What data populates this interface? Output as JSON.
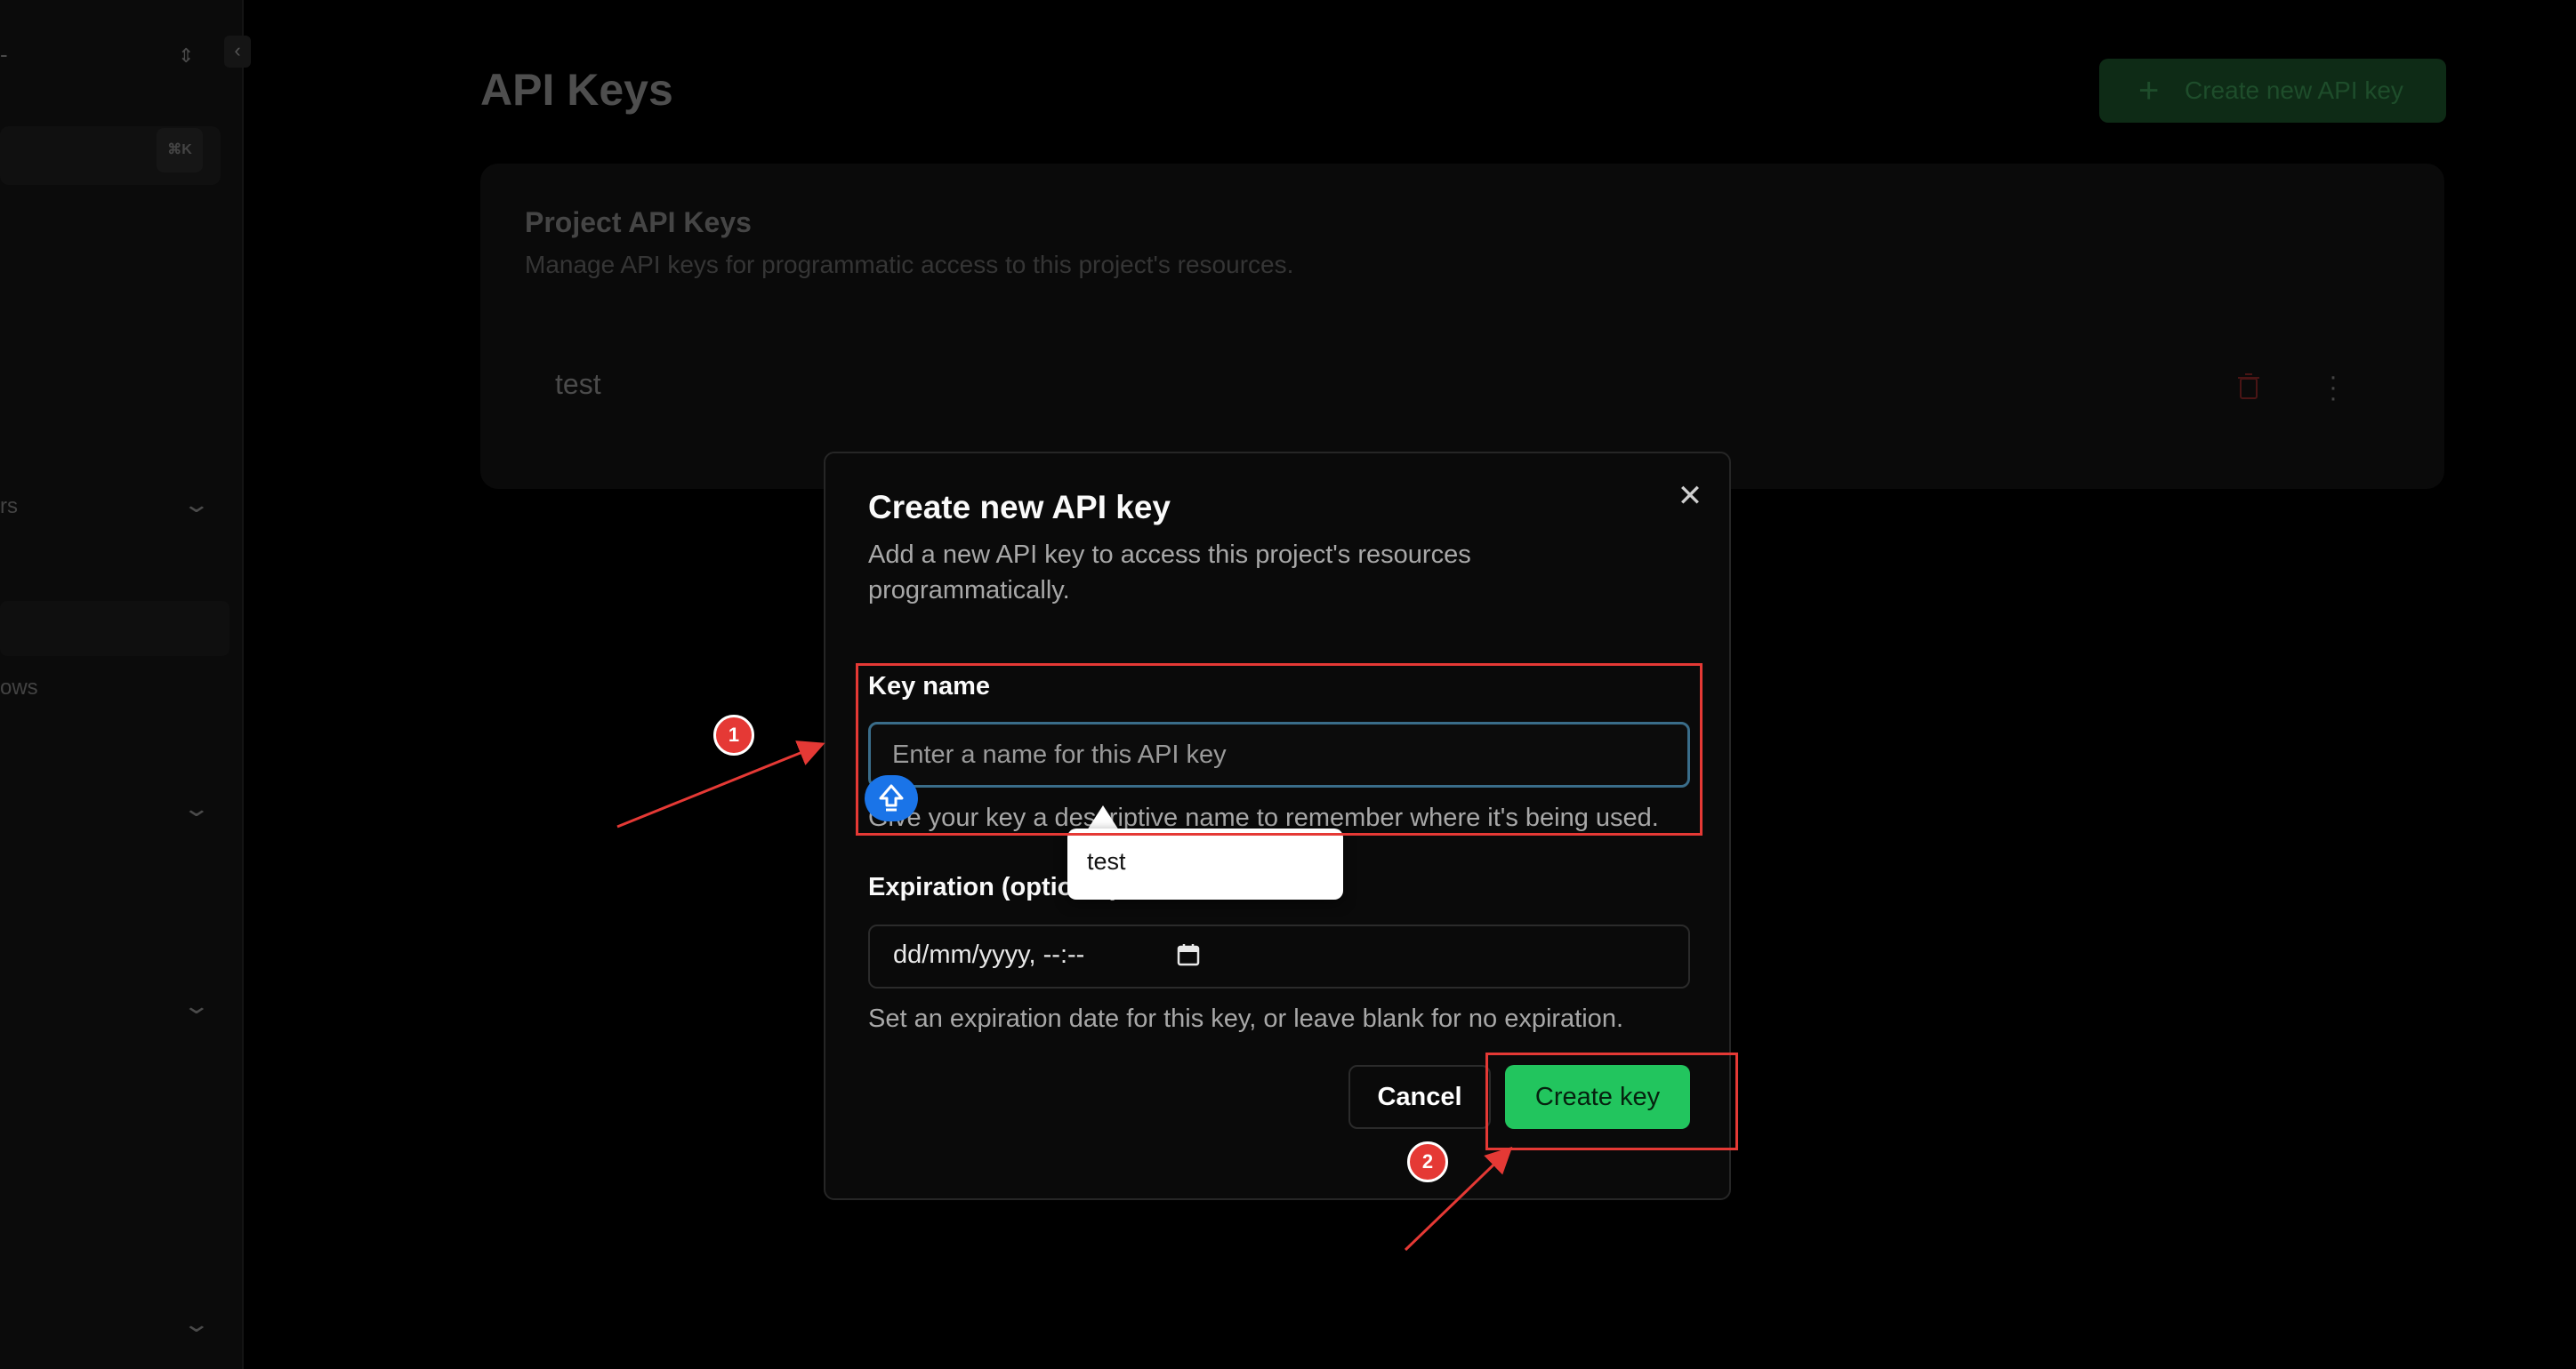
{
  "sidebar": {
    "kbd_hint": "⌘K",
    "items": [
      {
        "label": "rs"
      },
      {
        "label": "ows"
      }
    ]
  },
  "page": {
    "title": "API Keys",
    "create_button_label": "Create new API key",
    "card": {
      "title": "Project API Keys",
      "description": "Manage API keys for programmatic access to this project's resources.",
      "keys": [
        {
          "name": "test"
        }
      ]
    }
  },
  "dialog": {
    "title": "Create new API key",
    "description": "Add a new API key to access this project's resources programmatically.",
    "key_name": {
      "label": "Key name",
      "placeholder": "Enter a name for this API key",
      "hint": "Give your key a descriptive name to remember where it's being used."
    },
    "expiration": {
      "label": "Expiration (optional)",
      "value": "dd/mm/yyyy, --:--",
      "hint": "Set an expiration date for this key, or leave blank for no expiration."
    },
    "cancel_label": "Cancel",
    "create_label": "Create key"
  },
  "autocomplete": {
    "suggestions": [
      "test"
    ]
  },
  "annotations": {
    "badge_1": "1",
    "badge_2": "2",
    "color": "#e53935"
  },
  "colors": {
    "accent_green": "#22c55e",
    "input_focus": "#3a6d8a"
  }
}
